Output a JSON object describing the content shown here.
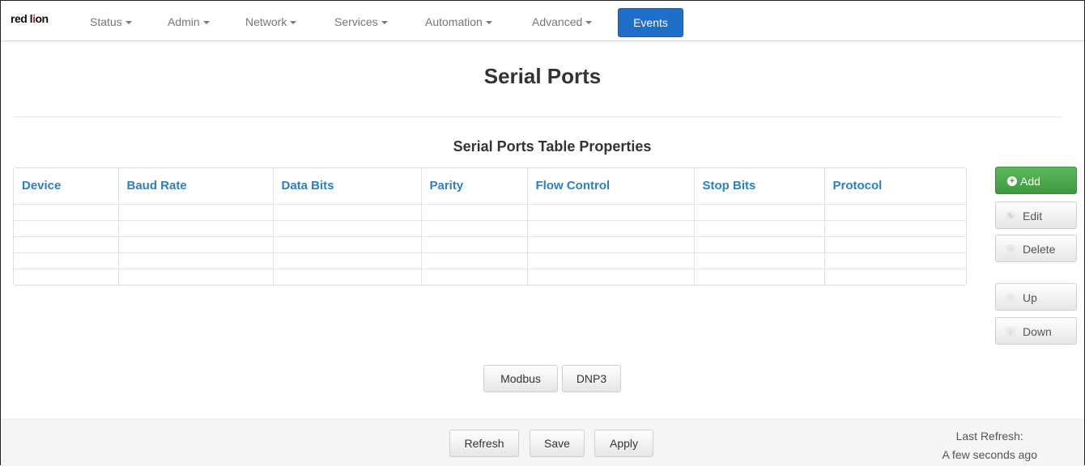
{
  "brand": {
    "logo_prefix": "red l",
    "logo_accent": "i",
    "logo_suffix": "on"
  },
  "nav": {
    "items": [
      {
        "label": "Status"
      },
      {
        "label": "Admin"
      },
      {
        "label": "Network"
      },
      {
        "label": "Services"
      },
      {
        "label": "Automation"
      },
      {
        "label": "Advanced"
      }
    ],
    "active_label": "Events"
  },
  "page": {
    "title": "Serial Ports",
    "table_title": "Serial Ports Table Properties"
  },
  "table": {
    "columns": [
      "Device",
      "Baud Rate",
      "Data Bits",
      "Parity",
      "Flow Control",
      "Stop Bits",
      "Protocol"
    ],
    "rows": [
      [
        "",
        "",
        "",
        "",
        "",
        "",
        ""
      ],
      [
        "",
        "",
        "",
        "",
        "",
        "",
        ""
      ],
      [
        "",
        "",
        "",
        "",
        "",
        "",
        ""
      ],
      [
        "",
        "",
        "",
        "",
        "",
        "",
        ""
      ],
      [
        "",
        "",
        "",
        "",
        "",
        "",
        ""
      ]
    ]
  },
  "actions": {
    "add": "Add",
    "edit": "Edit",
    "delete": "Delete",
    "up": "Up",
    "down": "Down"
  },
  "protocols": {
    "modbus": "Modbus",
    "dnp3": "DNP3"
  },
  "footer": {
    "refresh": "Refresh",
    "save": "Save",
    "apply": "Apply",
    "last_refresh_label": "Last Refresh:",
    "last_refresh_value": "A few seconds ago"
  },
  "colors": {
    "accent": "#1f6fc8",
    "add_green": "#4cae4c",
    "header_link": "#2a7fc8",
    "logo_red": "#d0202a"
  }
}
